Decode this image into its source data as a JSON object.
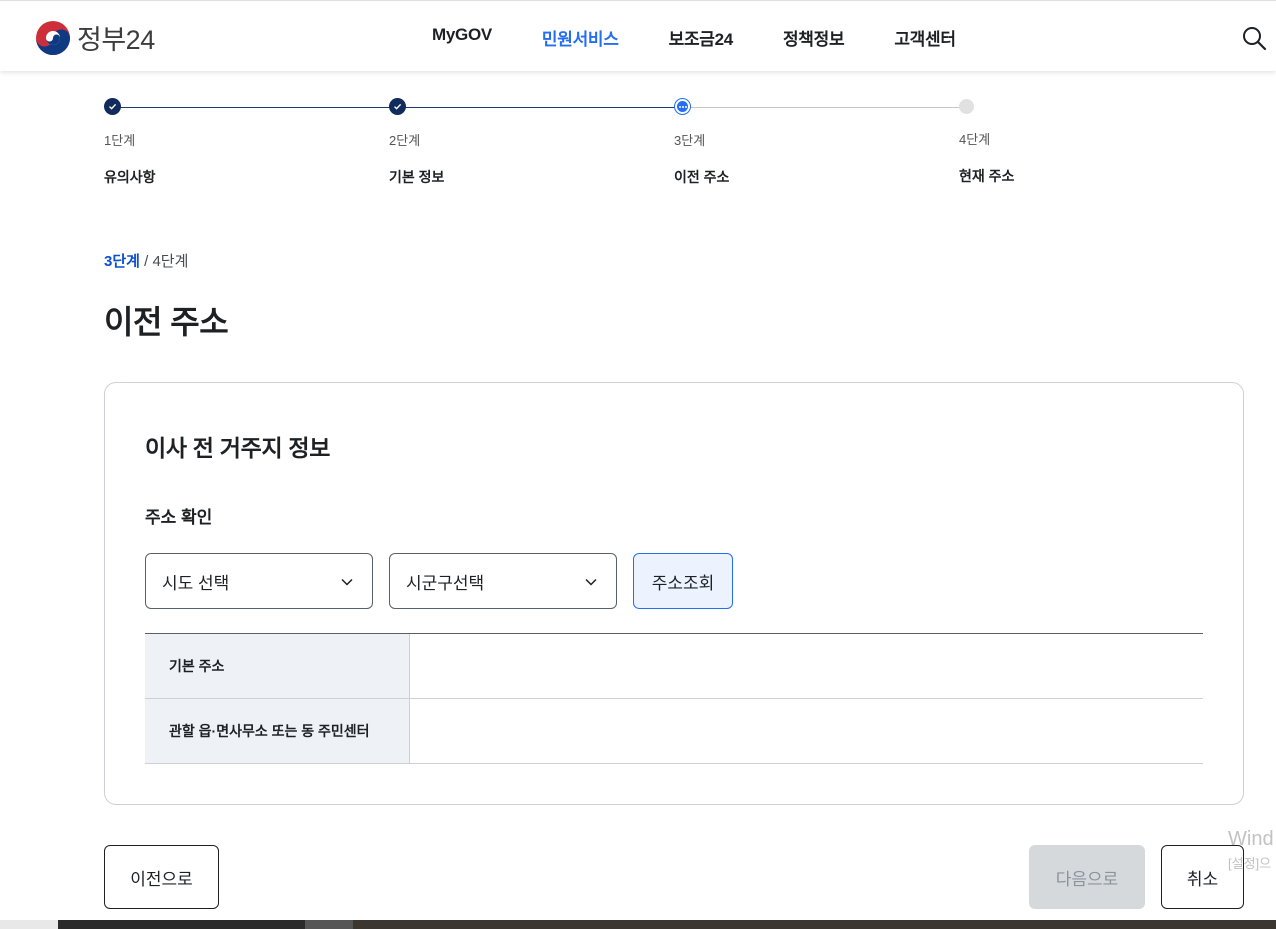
{
  "header": {
    "logo_text": "정부24",
    "nav": [
      {
        "label": "MyGOV",
        "active": false
      },
      {
        "label": "민원서비스",
        "active": true
      },
      {
        "label": "보조금24",
        "active": false
      },
      {
        "label": "정책정보",
        "active": false
      },
      {
        "label": "고객센터",
        "active": false
      }
    ]
  },
  "stepper": {
    "steps": [
      {
        "num": "1단계",
        "name": "유의사항",
        "status": "done"
      },
      {
        "num": "2단계",
        "name": "기본 정보",
        "status": "done"
      },
      {
        "num": "3단계",
        "name": "이전 주소",
        "status": "current"
      },
      {
        "num": "4단계",
        "name": "현재 주소",
        "status": "todo"
      }
    ]
  },
  "progress": {
    "current": "3단계",
    "separator": " / ",
    "total": "4단계"
  },
  "page_title": "이전 주소",
  "card": {
    "title": "이사 전 거주지 정보",
    "field_label": "주소 확인",
    "sido_select": "시도 선택",
    "sigungu_select": "시군구선택",
    "lookup_button": "주소조회",
    "table": [
      {
        "label": "기본 주소",
        "value": ""
      },
      {
        "label": "관할 읍·면사무소 또는 동 주민센터",
        "value": ""
      }
    ]
  },
  "buttons": {
    "prev": "이전으로",
    "next": "다음으로",
    "cancel": "취소"
  },
  "watermark": {
    "line1": "Wind",
    "line2": "[설정]으"
  },
  "colors": {
    "accent": "#256ef4",
    "done": "#102b5c",
    "table_header_bg": "#eef2f7"
  }
}
